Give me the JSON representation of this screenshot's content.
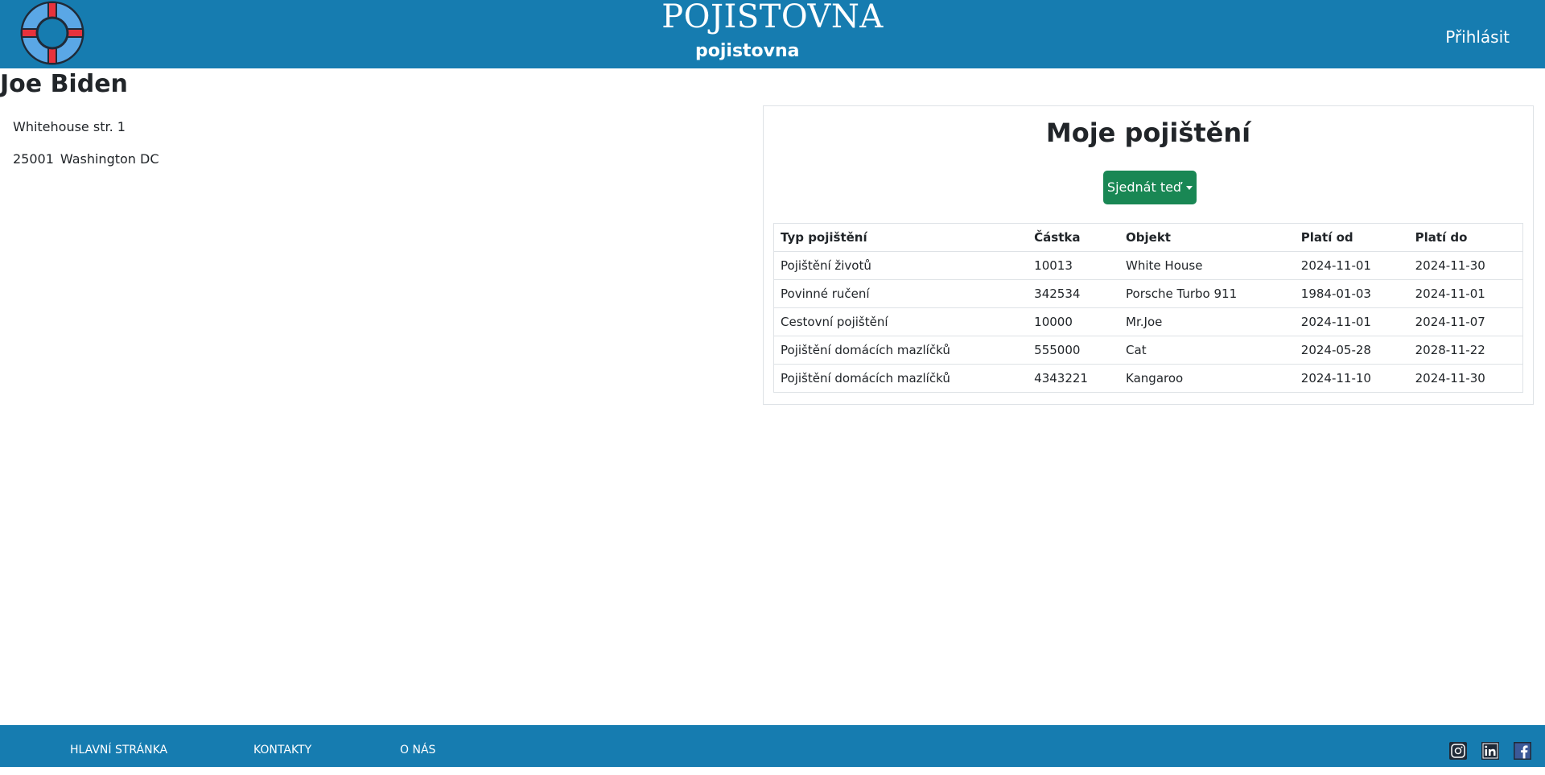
{
  "header": {
    "brand_title": "POJISTOVNA",
    "brand_subtitle": "pojistovna",
    "login_label": "Přihlásit",
    "logo_icon": "lifebuoy-icon",
    "colors": {
      "bar": "#167cb0",
      "ring_red": "#e8323c",
      "ring_blue": "#5aa7e6"
    }
  },
  "profile": {
    "name": "Joe Biden",
    "street": "Whitehouse str. 1",
    "zip": "25001",
    "city": "Washington DC"
  },
  "insurance": {
    "title": "Moje pojištění",
    "order_button_label": "Sjednát teď",
    "order_button_color": "#198754",
    "columns": [
      "Typ pojištění",
      "Částka",
      "Objekt",
      "Platí od",
      "Platí do"
    ],
    "rows": [
      [
        "Pojištění životů",
        "10013",
        "White House",
        "2024-11-01",
        "2024-11-30"
      ],
      [
        "Povinné ručení",
        "342534",
        "Porsche Turbo 911",
        "1984-01-03",
        "2024-11-01"
      ],
      [
        "Cestovní pojištění",
        "10000",
        "Mr.Joe",
        "2024-11-01",
        "2024-11-07"
      ],
      [
        "Pojištění domácích mazlíčků",
        "555000",
        "Cat",
        "2024-05-28",
        "2028-11-22"
      ],
      [
        "Pojištění domácích mazlíčků",
        "4343221",
        "Kangaroo",
        "2024-11-10",
        "2024-11-30"
      ]
    ]
  },
  "footer": {
    "links": [
      "Hlavní stránka",
      "Kontakty",
      "O nás"
    ],
    "social_icons": [
      "instagram-icon",
      "linkedin-icon",
      "facebook-icon"
    ]
  }
}
